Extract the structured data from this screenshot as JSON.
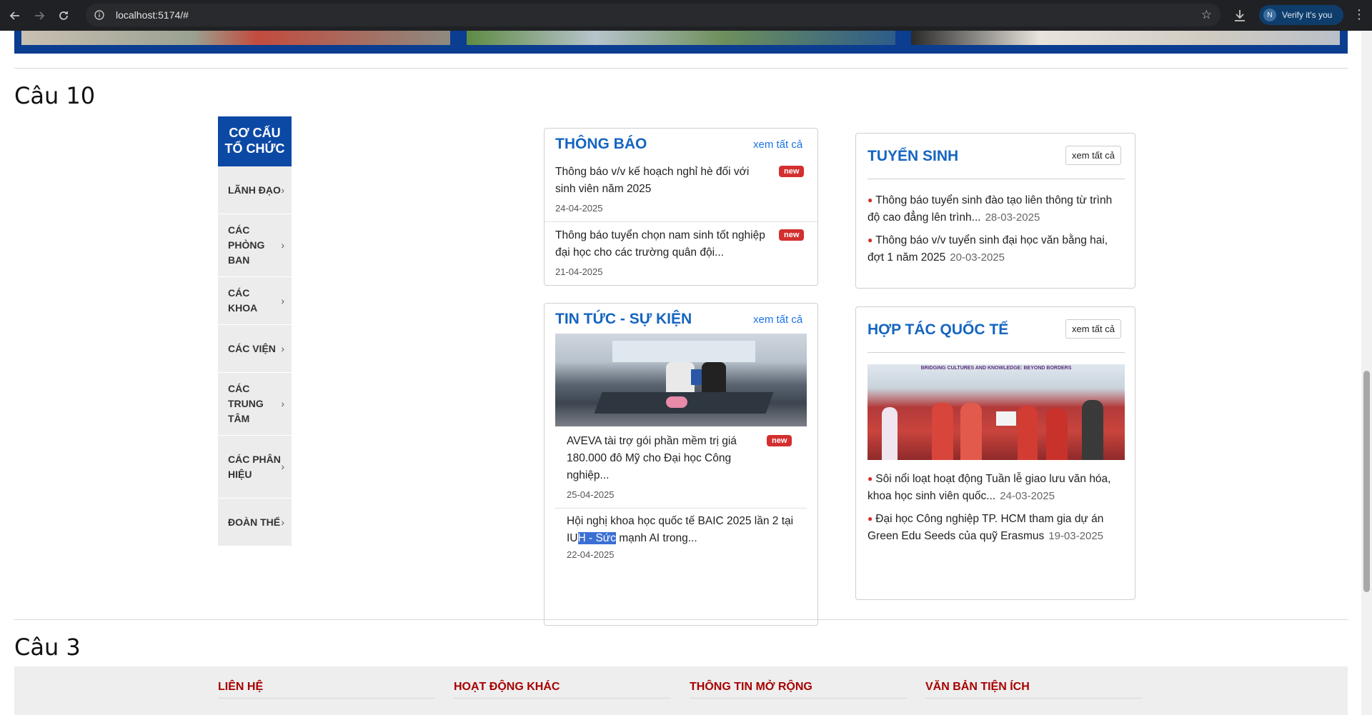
{
  "browser": {
    "url": "localhost:5174/#",
    "profile_label": "Verify it's you",
    "profile_initial": "N"
  },
  "section_10": {
    "title": "Câu 10"
  },
  "section_3": {
    "title": "Câu 3"
  },
  "sidebar": {
    "heading": "CƠ CẤU TỔ CHỨC",
    "items": [
      {
        "label": "LÃNH ĐẠO"
      },
      {
        "label": "CÁC PHÒNG BAN"
      },
      {
        "label": "CÁC KHOA"
      },
      {
        "label": "CÁC VIỆN"
      },
      {
        "label": "CÁC TRUNG TÂM"
      },
      {
        "label": "CÁC PHÂN HIỆU"
      },
      {
        "label": "ĐOÀN THỂ"
      }
    ]
  },
  "announcements": {
    "title": "THÔNG BÁO",
    "see_all": "xem tất cả",
    "items": [
      {
        "text": "Thông báo v/v kế hoạch nghỉ hè đối với sinh viên năm 2025",
        "date": "24-04-2025",
        "badge": "new"
      },
      {
        "text": "Thông báo tuyển chọn nam sinh tốt nghiệp đại học cho các trường quân đội...",
        "date": "21-04-2025",
        "badge": "new"
      }
    ]
  },
  "news": {
    "title": "TIN TỨC - SỰ KIỆN",
    "see_all": "xem tất cả",
    "items": [
      {
        "text": "AVEVA tài trợ gói phần mềm trị giá 180.000 đô Mỹ cho Đại học Công nghiệp...",
        "date": "25-04-2025",
        "badge": "new"
      },
      {
        "text_before": "Hội nghị khoa học quốc tế BAIC 2025 lần 2 tại IU",
        "text_selected": "H - Sức",
        "text_after": " mạnh AI trong...",
        "date": "22-04-2025"
      }
    ]
  },
  "admissions": {
    "title": "TUYỂN SINH",
    "see_all": "xem tất cả",
    "items": [
      {
        "text": "Thông báo tuyển sinh đào tạo liên thông từ trình độ cao đẳng lên trình...",
        "date": "28-03-2025"
      },
      {
        "text": "Thông báo v/v tuyển sinh đại học văn bằng hai, đợt 1 năm 2025",
        "date": "20-03-2025"
      }
    ]
  },
  "cooperation": {
    "title": "HỢP TÁC QUỐC TẾ",
    "see_all": "xem tất cả",
    "image_caption": "BRIDGING CULTURES AND KNOWLEDGE: BEYOND BORDERS",
    "items": [
      {
        "text": "Sôi nổi loạt hoạt động Tuần lễ giao lưu văn hóa, khoa học sinh viên quốc...",
        "date": "24-03-2025"
      },
      {
        "text": "Đại học Công nghiệp TP. HCM tham gia dự án Green Edu Seeds của quỹ Erasmus",
        "date": "19-03-2025"
      }
    ]
  },
  "footer": {
    "columns": [
      {
        "label": "LIÊN HỆ"
      },
      {
        "label": "HOẠT ĐỘNG KHÁC"
      },
      {
        "label": "THÔNG TIN MỞ RỘNG"
      },
      {
        "label": "VĂN BẢN TIỆN ÍCH"
      }
    ]
  },
  "colors": {
    "brand_blue": "#0b49a5",
    "link_blue": "#1565c0",
    "badge_red": "#d32f2f",
    "footer_heading": "#a80000"
  }
}
